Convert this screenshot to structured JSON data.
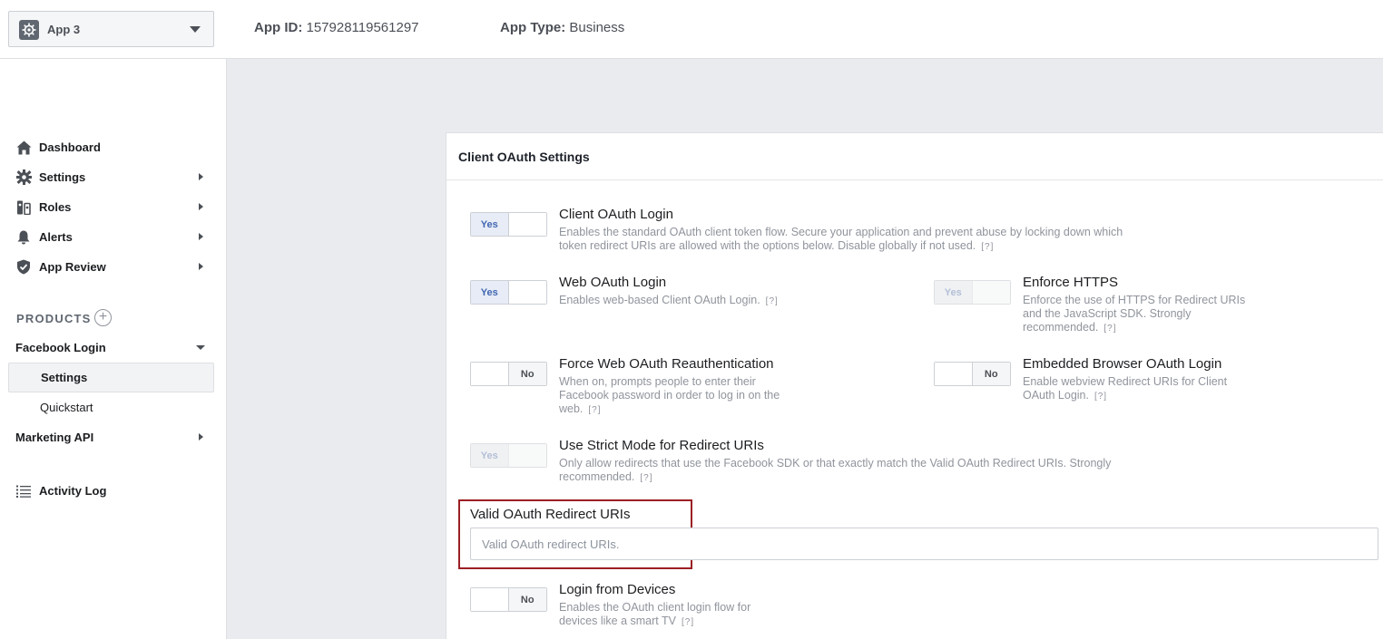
{
  "header": {
    "app_name": "App 3",
    "app_id_label": "App ID:",
    "app_id_value": "157928119561297",
    "app_type_label": "App Type:",
    "app_type_value": "Business"
  },
  "sidebar": {
    "items": [
      {
        "label": "Dashboard",
        "icon": "home-icon"
      },
      {
        "label": "Settings",
        "icon": "gear-icon"
      },
      {
        "label": "Roles",
        "icon": "roles-icon"
      },
      {
        "label": "Alerts",
        "icon": "bell-icon"
      },
      {
        "label": "App Review",
        "icon": "shield-check-icon"
      }
    ],
    "products_label": "PRODUCTS",
    "add_product": "+",
    "facebook_login": "Facebook Login",
    "fb_settings": "Settings",
    "fb_quickstart": "Quickstart",
    "marketing_api": "Marketing API",
    "activity_log": "Activity Log"
  },
  "panel": {
    "title": "Client OAuth Settings",
    "settings": {
      "client_oauth": {
        "toggle": "Yes",
        "title": "Client OAuth Login",
        "desc": "Enables the standard OAuth client token flow. Secure your application and prevent abuse by locking down which token redirect URIs are allowed with the options below. Disable globally if not used.",
        "help": "[?]"
      },
      "web_oauth": {
        "toggle": "Yes",
        "title": "Web OAuth Login",
        "desc": "Enables web-based Client OAuth Login.",
        "help": "[?]"
      },
      "enforce_https": {
        "toggle": "Yes",
        "title": "Enforce HTTPS",
        "desc": "Enforce the use of HTTPS for Redirect URIs and the JavaScript SDK. Strongly recommended.",
        "help": "[?]"
      },
      "force_reauth": {
        "toggle": "No",
        "title": "Force Web OAuth Reauthentication",
        "desc": "When on, prompts people to enter their Facebook password in order to log in on the web.",
        "help": "[?]"
      },
      "embedded_browser": {
        "toggle": "No",
        "title": "Embedded Browser OAuth Login",
        "desc": "Enable webview Redirect URIs for Client OAuth Login.",
        "help": "[?]"
      },
      "strict_mode": {
        "toggle": "Yes",
        "title": "Use Strict Mode for Redirect URIs",
        "desc": "Only allow redirects that use the Facebook SDK or that exactly match the Valid OAuth Redirect URIs. Strongly recommended.",
        "help": "[?]"
      },
      "login_devices": {
        "toggle": "No",
        "title": "Login from Devices",
        "desc": "Enables the OAuth client login flow for devices like a smart TV",
        "help": "[?]"
      }
    },
    "redirect_uris": {
      "label": "Valid OAuth Redirect URIs",
      "placeholder": "Valid OAuth redirect URIs.",
      "value": ""
    }
  },
  "colors": {
    "highlight_border": "#9b1f24",
    "toggle_on_text": "#4267b2",
    "main_background": "#e9ebee"
  }
}
